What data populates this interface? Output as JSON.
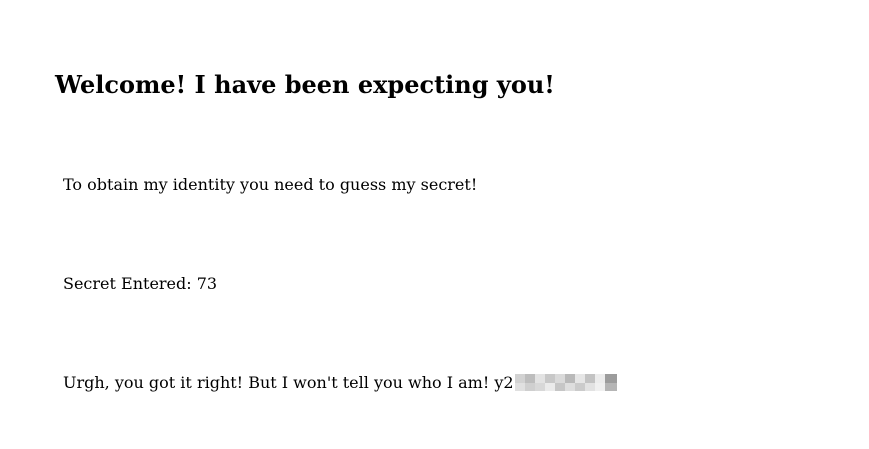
{
  "heading": "Welcome! I have been expecting you!",
  "intro_text": "To obtain my identity you need to guess my secret!",
  "secret": {
    "label": "Secret Entered:",
    "value": "73"
  },
  "result": {
    "message": "Urgh, you got it right! But I won't tell you who I am!",
    "identity_prefix": "y2"
  }
}
